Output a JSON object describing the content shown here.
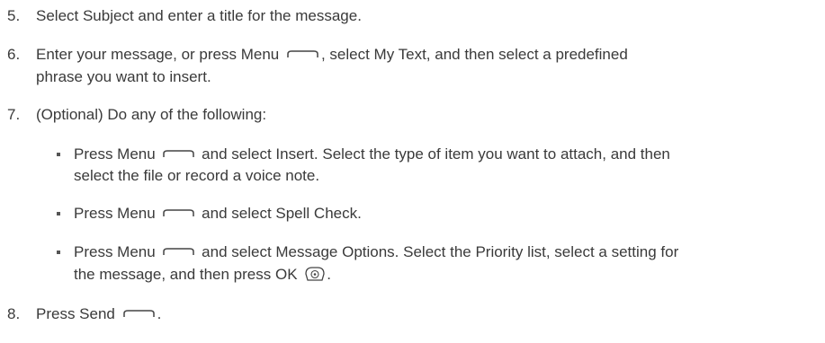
{
  "steps": {
    "s5": {
      "num": "5.",
      "text": "Select Subject and enter a title for the message."
    },
    "s6": {
      "num": "6.",
      "a": "Enter your message, or press Menu",
      "b": ", select My Text, and then select a predefined",
      "c": "phrase you want to insert."
    },
    "s7": {
      "num": "7.",
      "text": "(Optional) Do any of the following:"
    },
    "s8": {
      "num": "8.",
      "a": "Press Send",
      "b": "."
    }
  },
  "bullets": {
    "b1": {
      "a": "Press Menu",
      "b": "and select Insert. Select the type of item you want to attach, and then",
      "c": "select the file or record a voice note."
    },
    "b2": {
      "a": "Press Menu",
      "b": "and select Spell Check."
    },
    "b3": {
      "a": "Press Menu",
      "b": "and select Message Options. Select the Priority list, select a setting for",
      "c": "the message, and then press OK",
      "d": "."
    }
  },
  "icons": {
    "softkey": "menu-softkey-icon",
    "ok": "ok-button-icon"
  }
}
